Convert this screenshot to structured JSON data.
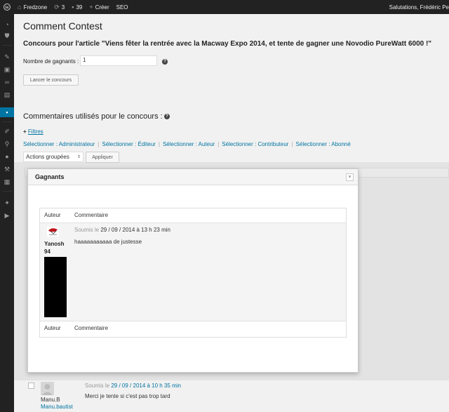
{
  "adminbar": {
    "site_name": "Fredzone",
    "updates_count": "3",
    "comments_count": "39",
    "new_label": "Créer",
    "seo_label": "SEO",
    "greeting": "Salutations, Frédéric Pe"
  },
  "icons": {
    "wp_logo": "wordpress-logo-icon",
    "home": "home-icon",
    "updates": "refresh-icon",
    "comments": "comment-bubble-icon",
    "new": "plus-icon"
  },
  "page": {
    "title": "Comment Contest",
    "article_heading": "Concours pour l'article \"Viens fêter la rentrée avec la Macway Expo 2014, et tente de gagner une Novodio PureWatt 6000 !\"",
    "winners_label": "Nombre de gagnants :",
    "winners_value": "1",
    "launch_button": "Lancer le concours",
    "comments_heading": "Commentaires utilisés pour le concours :",
    "filters_label": "Filtres",
    "select_links": [
      "Sélectionner : Administrateur",
      "Sélectionner : Éditeur",
      "Sélectionner : Auteur",
      "Sélectionner : Contributeur",
      "Sélectionner : Abonné"
    ],
    "bulk_actions": "Actions groupées",
    "apply_button": "Appliquer"
  },
  "modal": {
    "title": "Gagnants",
    "close_symbol": "×",
    "col_author": "Auteur",
    "col_comment": "Commentaire",
    "winner": {
      "name": "Yanosh 94",
      "submitted_prefix": "Soumis le",
      "date": "29 / 09 / 2014 à 13 h 23 min",
      "text": "haaaaaaaaaaa de justesse"
    }
  },
  "bottom_comment": {
    "name": "Manu.B",
    "username": "Manu.bautist",
    "submitted_prefix": "Soumis le",
    "date": "29 / 09 / 2014 à 10 h 35 min",
    "text": "Merci je tente si c'est pas trop tard"
  },
  "colors": {
    "adminbar_bg": "#222222",
    "accent_blue": "#0074a2",
    "page_bg": "#f1f1f1"
  }
}
